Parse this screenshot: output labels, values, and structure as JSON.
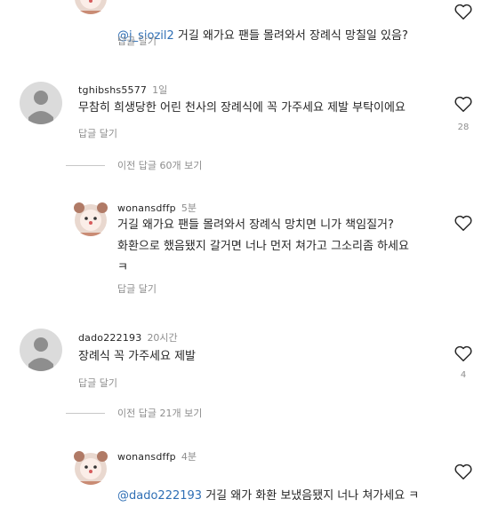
{
  "comments": [
    {
      "mention": "@j_siozil2",
      "text": " 거길 왜가요 팬들 몰려와서 장례식 망칠일 있음?",
      "reply": "답글 달기"
    },
    {
      "user": "tghibshs5577",
      "time": "1일",
      "text": "무참히 희생당한 어린 천사의 장례식에 꼭 가주세요 제발 부탁이에요",
      "reply": "답글 달기",
      "likes": "28"
    },
    {
      "user": "wonansdffp",
      "time": "5분",
      "text": "거길 왜가요 팬들 몰려와서 장례식 망치면 니가 책임질거?\n화환으로 했음됐지 갈거면 너나 먼저 쳐가고 그소리좀 하세요\nㅋ",
      "reply": "답글 달기"
    },
    {
      "user": "dado222193",
      "time": "20시간",
      "text": "장례식 꼭 가주세요 제발",
      "reply": "답글 달기",
      "likes": "4"
    },
    {
      "user": "wonansdffp",
      "time": "4분",
      "mention": "@dado222193",
      "text": " 거길 왜가 화환 보냈음됐지 너나 쳐가세요 ㅋ"
    }
  ],
  "view_more": [
    "이전 답글 60개 보기",
    "이전 답글 21개 보기"
  ],
  "colors": {
    "mention": "#2f6fb5",
    "muted": "#8e8e8e",
    "avatar_gray": "#dbdbdb"
  }
}
